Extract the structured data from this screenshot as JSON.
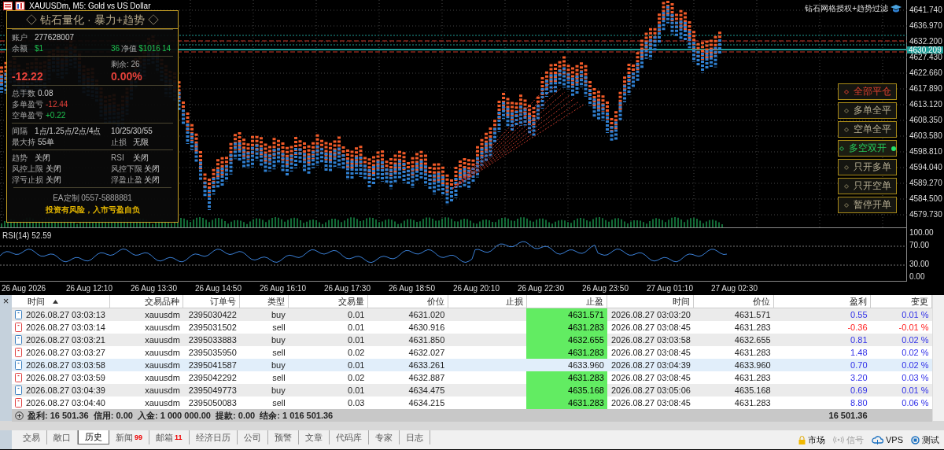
{
  "chart": {
    "title": "XAUUSDm, M5:  Gold vs US Dollar",
    "indicator_label": "钻石网格授权+趋势过滤",
    "price_ticks": [
      "4641.740",
      "4636.970",
      "4632.200",
      "4627.430",
      "4622.660",
      "4617.890",
      "4613.120",
      "4608.350",
      "4603.580",
      "4598.810",
      "4594.040",
      "4589.270",
      "4584.500",
      "4579.730"
    ],
    "current_price": "4630.209",
    "rsi_label": "RSI(14) 52.59",
    "rsi_ticks": [
      "100.00",
      "70.00",
      "30.00",
      "0.00"
    ],
    "time_ticks": [
      "26 Aug 2026",
      "26 Aug 12:10",
      "26 Aug 13:30",
      "26 Aug 14:50",
      "26 Aug 16:10",
      "26 Aug 17:30",
      "26 Aug 18:50",
      "26 Aug 20:10",
      "26 Aug 22:30",
      "26 Aug 23:50",
      "27 Aug 01:10",
      "27 Aug 02:30"
    ]
  },
  "panel": {
    "title": "◇ 钻石量化 · 暴力+趋势 ◇",
    "sections": [
      {
        "rows": [
          {
            "left": [
              {
                "text": "账户",
                "kind": "label"
              },
              {
                "text": "277628007",
                "kind": "value"
              }
            ]
          },
          {
            "left": [
              {
                "text": "余额",
                "kind": "label"
              },
              {
                "text": "$1",
                "kind": "green"
              }
            ],
            "right": [
              {
                "text": "36",
                "kind": "green"
              },
              {
                "text": "净值",
                "kind": "label"
              },
              {
                "text": "$1016",
                "kind": "green"
              },
              {
                "text": "14",
                "kind": "green"
              }
            ]
          }
        ]
      },
      {
        "rows": [
          {
            "right": [
              {
                "text": "剩余: 26",
                "kind": "label"
              }
            ]
          },
          {
            "left": [
              {
                "text": "-12.22",
                "kind": "big_red"
              }
            ],
            "right": [
              {
                "text": "0.00%",
                "kind": "big_red"
              }
            ]
          }
        ]
      },
      {
        "rows": [
          {
            "left": [
              {
                "text": "总手数",
                "kind": "label"
              },
              {
                "text": "0.08",
                "kind": "value"
              }
            ]
          },
          {
            "left": [
              {
                "text": "多单盈亏",
                "kind": "label"
              },
              {
                "text": "-12.44",
                "kind": "red"
              }
            ]
          },
          {
            "left": [
              {
                "text": "空单盈亏",
                "kind": "label"
              },
              {
                "text": "+0.22",
                "kind": "green"
              }
            ]
          }
        ]
      },
      {
        "rows": [
          {
            "left": [
              {
                "text": "间隔",
                "kind": "label"
              },
              {
                "text": "1点/1.25点/2点/4点",
                "kind": "value"
              }
            ],
            "right": [
              {
                "text": "10/25/30/55",
                "kind": "value"
              }
            ]
          },
          {
            "left": [
              {
                "text": "最大持",
                "kind": "label"
              },
              {
                "text": "55单",
                "kind": "value"
              }
            ],
            "right": [
              {
                "text": "止损",
                "kind": "label"
              },
              {
                "text": "无限",
                "kind": "value"
              }
            ]
          }
        ]
      },
      {
        "rows": [
          {
            "left": [
              {
                "text": "趋势",
                "kind": "label"
              },
              {
                "text": "关闭",
                "kind": "value"
              }
            ],
            "right": [
              {
                "text": "RSI",
                "kind": "label"
              },
              {
                "text": "关闭",
                "kind": "value"
              }
            ]
          },
          {
            "left": [
              {
                "text": "风控上限",
                "kind": "label"
              },
              {
                "text": "关闭",
                "kind": "value"
              }
            ],
            "right": [
              {
                "text": "风控下限",
                "kind": "label"
              },
              {
                "text": "关闭",
                "kind": "value"
              }
            ]
          },
          {
            "left": [
              {
                "text": "浮亏止损",
                "kind": "label"
              },
              {
                "text": "关闭",
                "kind": "value"
              }
            ],
            "right": [
              {
                "text": "浮盈止盈",
                "kind": "label"
              },
              {
                "text": "关闭",
                "kind": "value"
              }
            ]
          }
        ]
      }
    ],
    "contact": "EA定制 0557-5888881",
    "warning": "投资有风险，入市亏盈自负"
  },
  "buttons": [
    {
      "label": "全部平仓",
      "kind": "danger",
      "selected": false
    },
    {
      "label": "多单全平",
      "kind": "normal",
      "selected": false
    },
    {
      "label": "空单全平",
      "kind": "normal",
      "selected": false
    },
    {
      "label": "多空双开",
      "kind": "normal",
      "selected": true
    },
    {
      "label": "只开多单",
      "kind": "normal",
      "selected": false
    },
    {
      "label": "只开空单",
      "kind": "normal",
      "selected": false
    },
    {
      "label": "暂停开单",
      "kind": "normal",
      "selected": false
    }
  ],
  "table": {
    "close": "×",
    "columns": [
      "时间",
      "交易品种",
      "订单号",
      "类型",
      "交易量",
      "价位",
      "止损",
      "止盈",
      "时间",
      "价位",
      "盈利",
      "变更"
    ],
    "rows": [
      {
        "kind": "buy",
        "selected": false,
        "tp_hit": true,
        "loss": false,
        "cells": [
          "2026.08.27 03:03:13",
          "xauusdm",
          "2395030422",
          "buy",
          "0.01",
          "4631.020",
          "",
          "4631.571",
          "2026.08.27 03:03:20",
          "4631.571",
          "0.55",
          "0.01 %"
        ]
      },
      {
        "kind": "sell",
        "selected": false,
        "tp_hit": true,
        "loss": true,
        "cells": [
          "2026.08.27 03:03:14",
          "xauusdm",
          "2395031502",
          "sell",
          "0.01",
          "4630.916",
          "",
          "4631.283",
          "2026.08.27 03:08:45",
          "4631.283",
          "-0.36",
          "-0.01 %"
        ]
      },
      {
        "kind": "buy",
        "selected": false,
        "tp_hit": true,
        "loss": false,
        "cells": [
          "2026.08.27 03:03:21",
          "xauusdm",
          "2395033883",
          "buy",
          "0.01",
          "4631.850",
          "",
          "4632.655",
          "2026.08.27 03:03:58",
          "4632.655",
          "0.81",
          "0.02 %"
        ]
      },
      {
        "kind": "sell",
        "selected": false,
        "tp_hit": true,
        "loss": false,
        "cells": [
          "2026.08.27 03:03:27",
          "xauusdm",
          "2395035950",
          "sell",
          "0.02",
          "4632.027",
          "",
          "4631.283",
          "2026.08.27 03:08:45",
          "4631.283",
          "1.48",
          "0.02 %"
        ]
      },
      {
        "kind": "buy",
        "selected": true,
        "tp_hit": false,
        "loss": false,
        "cells": [
          "2026.08.27 03:03:58",
          "xauusdm",
          "2395041587",
          "buy",
          "0.01",
          "4633.261",
          "",
          "4633.960",
          "2026.08.27 03:04:39",
          "4633.960",
          "0.70",
          "0.02 %"
        ]
      },
      {
        "kind": "sell",
        "selected": false,
        "tp_hit": true,
        "loss": false,
        "cells": [
          "2026.08.27 03:03:59",
          "xauusdm",
          "2395042292",
          "sell",
          "0.02",
          "4632.887",
          "",
          "4631.283",
          "2026.08.27 03:08:45",
          "4631.283",
          "3.20",
          "0.03 %"
        ]
      },
      {
        "kind": "buy",
        "selected": false,
        "tp_hit": true,
        "loss": false,
        "cells": [
          "2026.08.27 03:04:39",
          "xauusdm",
          "2395049773",
          "buy",
          "0.01",
          "4634.475",
          "",
          "4635.168",
          "2026.08.27 03:05:06",
          "4635.168",
          "0.69",
          "0.01 %"
        ]
      },
      {
        "kind": "sell",
        "selected": false,
        "tp_hit": true,
        "loss": false,
        "cells": [
          "2026.08.27 03:04:40",
          "xauusdm",
          "2395050083",
          "sell",
          "0.03",
          "4634.215",
          "",
          "4631.283",
          "2026.08.27 03:08:45",
          "4631.283",
          "8.80",
          "0.06 %"
        ]
      }
    ],
    "summary": "盈利: 16 501.36  信用: 0.00  入金: 1 000 000.00  提款: 0.00  结余: 1 016 501.36",
    "summary_total": "16 501.36"
  },
  "tabs": [
    {
      "label": "交易",
      "selected": false
    },
    {
      "label": "敞口",
      "selected": false
    },
    {
      "label": "历史",
      "selected": true
    },
    {
      "label": "新闻",
      "badge": "99",
      "selected": false
    },
    {
      "label": "邮箱",
      "badge": "11",
      "selected": false
    },
    {
      "label": "经济日历",
      "selected": false
    },
    {
      "label": "公司",
      "selected": false
    },
    {
      "label": "预警",
      "selected": false
    },
    {
      "label": "文章",
      "selected": false
    },
    {
      "label": "代码库",
      "selected": false
    },
    {
      "label": "专家",
      "selected": false
    },
    {
      "label": "日志",
      "selected": false
    }
  ],
  "status": [
    {
      "kind": "market",
      "label": "市场",
      "disabled": false
    },
    {
      "kind": "signals",
      "label": "信号",
      "disabled": true
    },
    {
      "kind": "vps",
      "label": "VPS",
      "disabled": false
    },
    {
      "kind": "tester",
      "label": "测试",
      "disabled": false
    }
  ]
}
